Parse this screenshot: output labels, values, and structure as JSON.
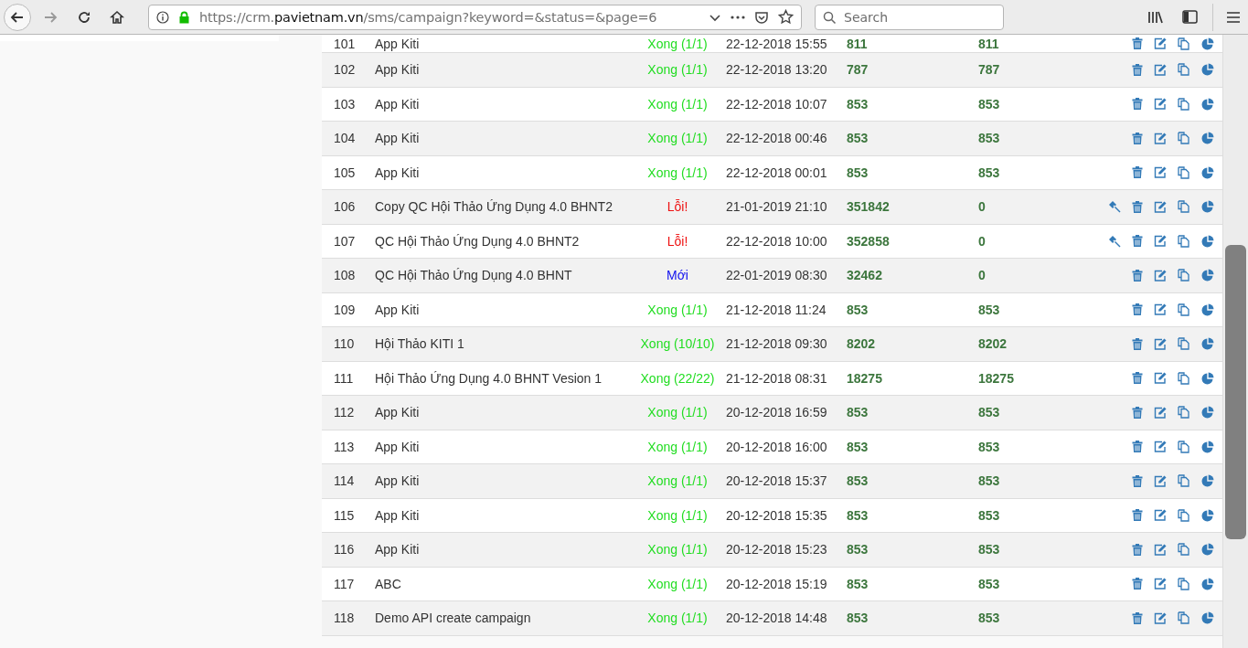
{
  "browser": {
    "url_prefix": "https://crm.",
    "url_host": "pavietnam.vn",
    "url_path": "/sms/campaign?keyword=&status=&page=6",
    "search": {
      "placeholder": "Search"
    }
  },
  "campaigns": [
    {
      "number": "101",
      "name": "App Kiti",
      "status": "Xong (1/1)",
      "kind": "done",
      "date": "22-12-2018 15:55",
      "sent": "811",
      "success": "811",
      "retry_button": false
    },
    {
      "number": "102",
      "name": "App Kiti",
      "status": "Xong (1/1)",
      "kind": "done",
      "date": "22-12-2018 13:20",
      "sent": "787",
      "success": "787",
      "retry_button": false
    },
    {
      "number": "103",
      "name": "App Kiti",
      "status": "Xong (1/1)",
      "kind": "done",
      "date": "22-12-2018 10:07",
      "sent": "853",
      "success": "853",
      "retry_button": false
    },
    {
      "number": "104",
      "name": "App Kiti",
      "status": "Xong (1/1)",
      "kind": "done",
      "date": "22-12-2018 00:46",
      "sent": "853",
      "success": "853",
      "retry_button": false
    },
    {
      "number": "105",
      "name": "App Kiti",
      "status": "Xong (1/1)",
      "kind": "done",
      "date": "22-12-2018 00:01",
      "sent": "853",
      "success": "853",
      "retry_button": false
    },
    {
      "number": "106",
      "name": "Copy QC Hội Thảo Ứng Dụng 4.0 BHNT2",
      "status": "Lỗi!",
      "kind": "error",
      "date": "21-01-2019 21:10",
      "sent": "351842",
      "success": "0",
      "retry_button": true
    },
    {
      "number": "107",
      "name": "QC Hội Thảo Ứng Dụng 4.0 BHNT2",
      "status": "Lỗi!",
      "kind": "error",
      "date": "22-12-2018 10:00",
      "sent": "352858",
      "success": "0",
      "retry_button": true
    },
    {
      "number": "108",
      "name": "QC Hội Thảo Ứng Dụng 4.0 BHNT",
      "status": "Mới",
      "kind": "new",
      "date": "22-01-2019 08:30",
      "sent": "32462",
      "success": "0",
      "retry_button": false
    },
    {
      "number": "109",
      "name": "App Kiti",
      "status": "Xong (1/1)",
      "kind": "done",
      "date": "21-12-2018 11:24",
      "sent": "853",
      "success": "853",
      "retry_button": false
    },
    {
      "number": "110",
      "name": "Hội Thảo KITI 1",
      "status": "Xong (10/10)",
      "kind": "done",
      "date": "21-12-2018 09:30",
      "sent": "8202",
      "success": "8202",
      "retry_button": false
    },
    {
      "number": "111",
      "name": "Hội Thảo Ứng Dụng 4.0 BHNT Vesion 1",
      "status": "Xong (22/22)",
      "kind": "done",
      "date": "21-12-2018 08:31",
      "sent": "18275",
      "success": "18275",
      "retry_button": false
    },
    {
      "number": "112",
      "name": "App Kiti",
      "status": "Xong (1/1)",
      "kind": "done",
      "date": "20-12-2018 16:59",
      "sent": "853",
      "success": "853",
      "retry_button": false
    },
    {
      "number": "113",
      "name": "App Kiti",
      "status": "Xong (1/1)",
      "kind": "done",
      "date": "20-12-2018 16:00",
      "sent": "853",
      "success": "853",
      "retry_button": false
    },
    {
      "number": "114",
      "name": "App Kiti",
      "status": "Xong (1/1)",
      "kind": "done",
      "date": "20-12-2018 15:37",
      "sent": "853",
      "success": "853",
      "retry_button": false
    },
    {
      "number": "115",
      "name": "App Kiti",
      "status": "Xong (1/1)",
      "kind": "done",
      "date": "20-12-2018 15:35",
      "sent": "853",
      "success": "853",
      "retry_button": false
    },
    {
      "number": "116",
      "name": "App Kiti",
      "status": "Xong (1/1)",
      "kind": "done",
      "date": "20-12-2018 15:23",
      "sent": "853",
      "success": "853",
      "retry_button": false
    },
    {
      "number": "117",
      "name": "ABC",
      "status": "Xong (1/1)",
      "kind": "done",
      "date": "20-12-2018 15:19",
      "sent": "853",
      "success": "853",
      "retry_button": false
    },
    {
      "number": "118",
      "name": "Demo API create campaign",
      "status": "Xong (1/1)",
      "kind": "done",
      "date": "20-12-2018 14:48",
      "sent": "853",
      "success": "853",
      "retry_button": false
    }
  ]
}
